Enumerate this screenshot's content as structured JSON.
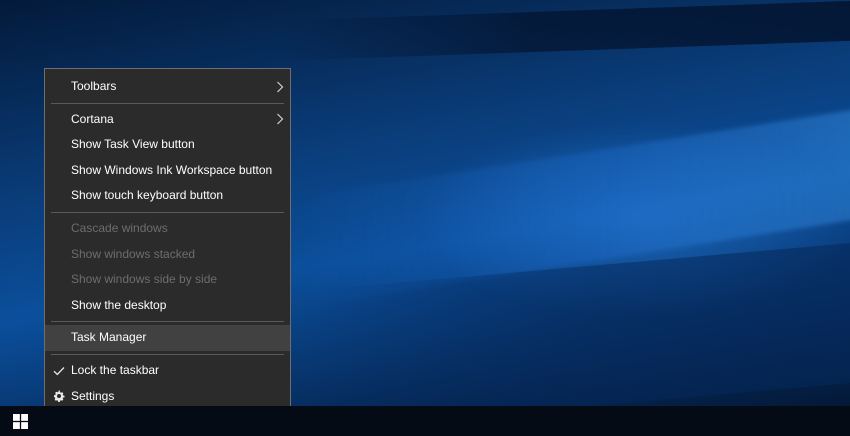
{
  "context_menu": {
    "toolbars": "Toolbars",
    "cortana": "Cortana",
    "show_task_view": "Show Task View button",
    "show_ink_workspace": "Show Windows Ink Workspace button",
    "show_touch_keyboard": "Show touch keyboard button",
    "cascade_windows": "Cascade windows",
    "show_windows_stacked": "Show windows stacked",
    "show_windows_side_by_side": "Show windows side by side",
    "show_desktop": "Show the desktop",
    "task_manager": "Task Manager",
    "lock_taskbar": "Lock the taskbar",
    "settings": "Settings"
  },
  "icons": {
    "submenu_arrow": "chevron-right-icon",
    "checkmark": "checkmark-icon",
    "settings": "gear-icon",
    "start": "windows-logo-icon"
  },
  "colors": {
    "menu_background": "#2b2b2b",
    "menu_border": "#6e6e6e",
    "highlight": "#414141",
    "disabled_text": "#6d6d6d",
    "taskbar": "#050b14",
    "accent_wallpaper": "#0b4f9c"
  }
}
